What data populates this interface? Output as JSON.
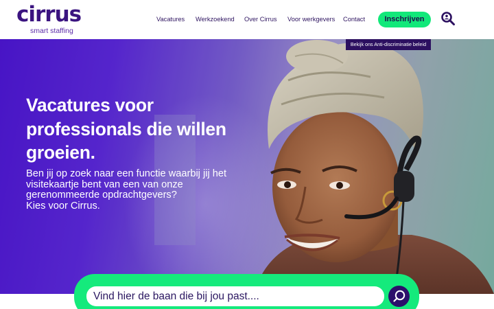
{
  "header": {
    "logo": {
      "name": "cirrus",
      "tagline": "smart staffing"
    },
    "nav": [
      {
        "label": "Vacatures"
      },
      {
        "label": "Werkzoekend"
      },
      {
        "label": "Over Cirrus"
      },
      {
        "label": "Voor werkgevers"
      },
      {
        "label": "Contact"
      }
    ],
    "cta_label": "Inschrijven",
    "search_icon": "search-person-icon"
  },
  "hero": {
    "badge": "Bekijk ons Anti-discriminatie beleid",
    "title_lines": [
      "Vacatures voor",
      "professionals die willen",
      "groeien."
    ],
    "subtitle_lines": [
      "Ben jij op zoek naar een functie waarbij jij het",
      "visitekaartje bent van een van onze",
      "gerenommeerde opdrachtgevers?",
      "Kies voor Cirrus."
    ]
  },
  "search": {
    "placeholder": "Vind hier de baan die bij jou past....",
    "button_icon": "search-icon"
  },
  "colors": {
    "brand_purple": "#3b1480",
    "accent_green": "#12e87a",
    "dark_purple": "#2c1060"
  }
}
